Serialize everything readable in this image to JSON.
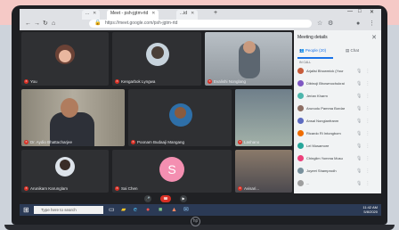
{
  "browser": {
    "tabs": [
      {
        "label": "..."
      },
      {
        "label": "Meet - psh-jgtm-rtd"
      },
      {
        "label": "...id"
      }
    ],
    "url": "https://meet.google.com/psh-jgtm-rtd",
    "window_controls": [
      "—",
      "□",
      "✕"
    ]
  },
  "participants_grid": [
    {
      "name": "You"
    },
    {
      "name": "Kengarbok Lyngwa"
    },
    {
      "name": "Evalishi Nonglang"
    },
    {
      "name": "Dr. Aydio Bhattacharjee"
    },
    {
      "name": "Poonam Budaaji Mangang"
    },
    {
      "name": "Lashano"
    },
    {
      "name": "Arunikam Karunglam"
    },
    {
      "name": "Sai Chen",
      "initial": "S"
    },
    {
      "name": "Avisari..."
    }
  ],
  "panel": {
    "title": "Meeting details",
    "tabs": [
      "People (20)",
      "Chat"
    ],
    "section": "IN CALL",
    "people": [
      {
        "name": "Arjalisi Bhowmick (Your",
        "color": "#c75b39"
      },
      {
        "name": "Dibinoji Bhowmochukrai",
        "color": "#7e57c2"
      },
      {
        "name": "Jerian Kharm",
        "color": "#4db6ac"
      },
      {
        "name": "Arunodu Pamma Bordar",
        "color": "#8d6e63"
      },
      {
        "name": "Ansal Nonglanfranm",
        "color": "#5c6bc0"
      },
      {
        "name": "Ricardo Ri Intongbom",
        "color": "#ef6c00"
      },
      {
        "name": "Lel Musamore",
        "color": "#26a69a"
      },
      {
        "name": "Chinglim Yomma Musu",
        "color": "#ec407a"
      },
      {
        "name": "Joyeet Shamprodh",
        "color": "#78909c"
      },
      {
        "name": "...",
        "color": "#9e9e9e"
      }
    ]
  },
  "taskbar": {
    "search_placeholder": "Type here to search",
    "time": "11:42 AM",
    "date": "5/8/2020"
  },
  "brand_logo": "hp"
}
